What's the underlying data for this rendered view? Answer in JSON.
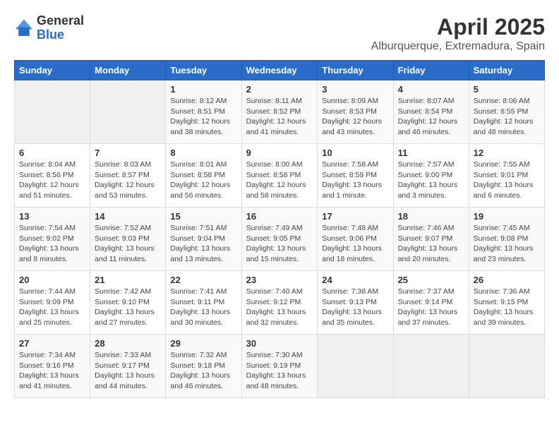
{
  "header": {
    "logo_line1": "General",
    "logo_line2": "Blue",
    "month": "April 2025",
    "location": "Alburquerque, Extremadura, Spain"
  },
  "weekdays": [
    "Sunday",
    "Monday",
    "Tuesday",
    "Wednesday",
    "Thursday",
    "Friday",
    "Saturday"
  ],
  "weeks": [
    [
      {
        "day": "",
        "info": ""
      },
      {
        "day": "",
        "info": ""
      },
      {
        "day": "1",
        "info": "Sunrise: 8:12 AM\nSunset: 8:51 PM\nDaylight: 12 hours and 38 minutes."
      },
      {
        "day": "2",
        "info": "Sunrise: 8:11 AM\nSunset: 8:52 PM\nDaylight: 12 hours and 41 minutes."
      },
      {
        "day": "3",
        "info": "Sunrise: 8:09 AM\nSunset: 8:53 PM\nDaylight: 12 hours and 43 minutes."
      },
      {
        "day": "4",
        "info": "Sunrise: 8:07 AM\nSunset: 8:54 PM\nDaylight: 12 hours and 46 minutes."
      },
      {
        "day": "5",
        "info": "Sunrise: 8:06 AM\nSunset: 8:55 PM\nDaylight: 12 hours and 48 minutes."
      }
    ],
    [
      {
        "day": "6",
        "info": "Sunrise: 8:04 AM\nSunset: 8:56 PM\nDaylight: 12 hours and 51 minutes."
      },
      {
        "day": "7",
        "info": "Sunrise: 8:03 AM\nSunset: 8:57 PM\nDaylight: 12 hours and 53 minutes."
      },
      {
        "day": "8",
        "info": "Sunrise: 8:01 AM\nSunset: 8:58 PM\nDaylight: 12 hours and 56 minutes."
      },
      {
        "day": "9",
        "info": "Sunrise: 8:00 AM\nSunset: 8:58 PM\nDaylight: 12 hours and 58 minutes."
      },
      {
        "day": "10",
        "info": "Sunrise: 7:58 AM\nSunset: 8:59 PM\nDaylight: 13 hours and 1 minute."
      },
      {
        "day": "11",
        "info": "Sunrise: 7:57 AM\nSunset: 9:00 PM\nDaylight: 13 hours and 3 minutes."
      },
      {
        "day": "12",
        "info": "Sunrise: 7:55 AM\nSunset: 9:01 PM\nDaylight: 13 hours and 6 minutes."
      }
    ],
    [
      {
        "day": "13",
        "info": "Sunrise: 7:54 AM\nSunset: 9:02 PM\nDaylight: 13 hours and 8 minutes."
      },
      {
        "day": "14",
        "info": "Sunrise: 7:52 AM\nSunset: 9:03 PM\nDaylight: 13 hours and 11 minutes."
      },
      {
        "day": "15",
        "info": "Sunrise: 7:51 AM\nSunset: 9:04 PM\nDaylight: 13 hours and 13 minutes."
      },
      {
        "day": "16",
        "info": "Sunrise: 7:49 AM\nSunset: 9:05 PM\nDaylight: 13 hours and 15 minutes."
      },
      {
        "day": "17",
        "info": "Sunrise: 7:48 AM\nSunset: 9:06 PM\nDaylight: 13 hours and 18 minutes."
      },
      {
        "day": "18",
        "info": "Sunrise: 7:46 AM\nSunset: 9:07 PM\nDaylight: 13 hours and 20 minutes."
      },
      {
        "day": "19",
        "info": "Sunrise: 7:45 AM\nSunset: 9:08 PM\nDaylight: 13 hours and 23 minutes."
      }
    ],
    [
      {
        "day": "20",
        "info": "Sunrise: 7:44 AM\nSunset: 9:09 PM\nDaylight: 13 hours and 25 minutes."
      },
      {
        "day": "21",
        "info": "Sunrise: 7:42 AM\nSunset: 9:10 PM\nDaylight: 13 hours and 27 minutes."
      },
      {
        "day": "22",
        "info": "Sunrise: 7:41 AM\nSunset: 9:11 PM\nDaylight: 13 hours and 30 minutes."
      },
      {
        "day": "23",
        "info": "Sunrise: 7:40 AM\nSunset: 9:12 PM\nDaylight: 13 hours and 32 minutes."
      },
      {
        "day": "24",
        "info": "Sunrise: 7:38 AM\nSunset: 9:13 PM\nDaylight: 13 hours and 35 minutes."
      },
      {
        "day": "25",
        "info": "Sunrise: 7:37 AM\nSunset: 9:14 PM\nDaylight: 13 hours and 37 minutes."
      },
      {
        "day": "26",
        "info": "Sunrise: 7:36 AM\nSunset: 9:15 PM\nDaylight: 13 hours and 39 minutes."
      }
    ],
    [
      {
        "day": "27",
        "info": "Sunrise: 7:34 AM\nSunset: 9:16 PM\nDaylight: 13 hours and 41 minutes."
      },
      {
        "day": "28",
        "info": "Sunrise: 7:33 AM\nSunset: 9:17 PM\nDaylight: 13 hours and 44 minutes."
      },
      {
        "day": "29",
        "info": "Sunrise: 7:32 AM\nSunset: 9:18 PM\nDaylight: 13 hours and 46 minutes."
      },
      {
        "day": "30",
        "info": "Sunrise: 7:30 AM\nSunset: 9:19 PM\nDaylight: 13 hours and 48 minutes."
      },
      {
        "day": "",
        "info": ""
      },
      {
        "day": "",
        "info": ""
      },
      {
        "day": "",
        "info": ""
      }
    ]
  ]
}
